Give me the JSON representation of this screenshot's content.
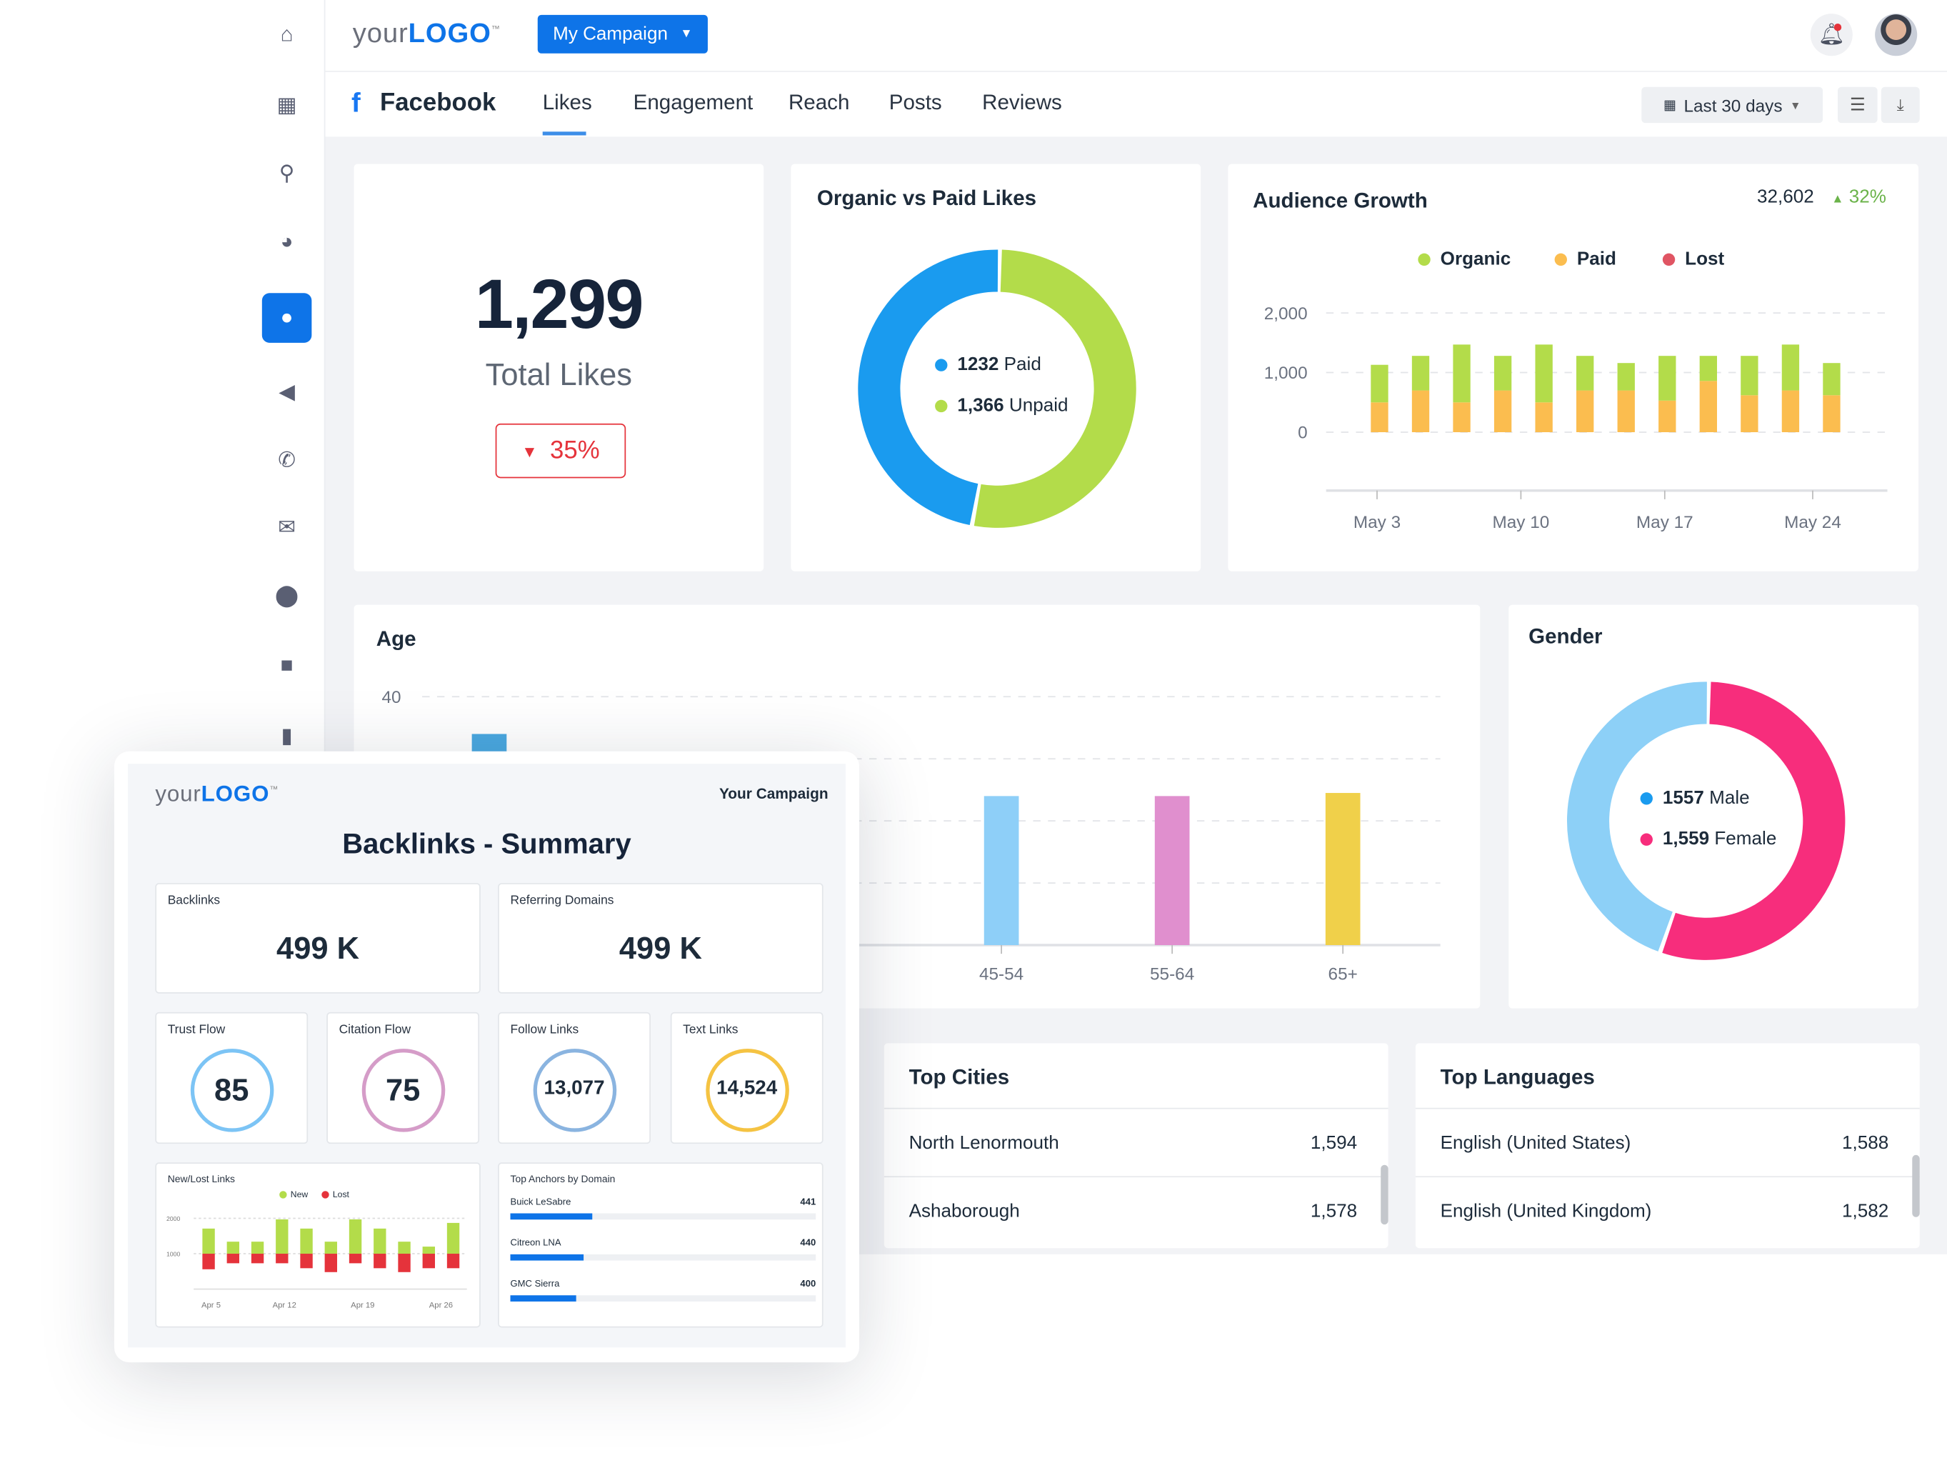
{
  "header": {
    "logo_prefix": "your",
    "logo_main": "LOGO",
    "logo_tm": "™",
    "campaign_button": "My Campaign"
  },
  "sidebar": {
    "items": [
      {
        "name": "home",
        "glyph": "⌂"
      },
      {
        "name": "dashboard",
        "glyph": "▦"
      },
      {
        "name": "search",
        "glyph": "⚲"
      },
      {
        "name": "pie-chart",
        "glyph": "◕"
      },
      {
        "name": "chat",
        "glyph": "●",
        "active": true
      },
      {
        "name": "megaphone",
        "glyph": "◀"
      },
      {
        "name": "phone",
        "glyph": "✆"
      },
      {
        "name": "mail",
        "glyph": "✉"
      },
      {
        "name": "location",
        "glyph": "⬤"
      },
      {
        "name": "briefcase",
        "glyph": "■"
      },
      {
        "name": "file",
        "glyph": "▮"
      }
    ]
  },
  "nav": {
    "platform": "Facebook",
    "tabs": [
      "Likes",
      "Engagement",
      "Reach",
      "Posts",
      "Reviews"
    ],
    "active_tab": "Likes",
    "date_range": "Last 30 days"
  },
  "total_likes": {
    "value": "1,299",
    "label": "Total Likes",
    "change": "35%",
    "direction": "down"
  },
  "organic_paid": {
    "title": "Organic vs Paid Likes",
    "paid_value": 1232,
    "paid_label": "1232",
    "paid_text": "Paid",
    "unpaid_value": 1366,
    "unpaid_label": "1,366",
    "unpaid_text": "Unpaid",
    "colors": {
      "paid": "#1a9bef",
      "unpaid": "#b3dc4a"
    }
  },
  "audience_growth": {
    "title": "Audience Growth",
    "total": "32,602",
    "change": "32%",
    "legend": [
      "Organic",
      "Paid",
      "Lost"
    ],
    "chart_data": {
      "type": "bar",
      "stacked": true,
      "ylim": [
        0,
        2000
      ],
      "yticks": [
        "2,000",
        "1,000",
        "0"
      ],
      "ytick_values": [
        2000,
        1000,
        0
      ],
      "xtick_labels": [
        "May 3",
        "May 10",
        "May 17",
        "May 24"
      ],
      "xtick_bar_index": [
        0,
        3.5,
        7,
        10.6
      ],
      "series": [
        {
          "name": "Paid",
          "color": "#fbbd4f",
          "values": [
            500,
            700,
            500,
            700,
            500,
            700,
            700,
            530,
            860,
            620,
            700,
            620
          ]
        },
        {
          "name": "Organic",
          "color": "#b3dc4a",
          "values": [
            630,
            580,
            970,
            580,
            970,
            580,
            460,
            750,
            420,
            660,
            770,
            540
          ]
        },
        {
          "name": "Lost",
          "color": "#e05563",
          "values": [
            0,
            0,
            0,
            0,
            0,
            0,
            0,
            0,
            0,
            0,
            0,
            0
          ]
        }
      ]
    }
  },
  "age": {
    "title": "Age",
    "chart_data": {
      "type": "bar",
      "ylim": [
        0,
        40
      ],
      "ytick": "40",
      "categories": [
        null,
        null,
        null,
        "45-54",
        "55-64",
        "65+"
      ],
      "values": [
        34,
        null,
        null,
        24,
        24,
        24.5
      ],
      "colors": [
        "#4aa8e0",
        "#8ecff8",
        "#8ecff8",
        "#8ecff8",
        "#e08fce",
        "#f0d04a"
      ]
    }
  },
  "gender": {
    "title": "Gender",
    "male_value": 1557,
    "male_label": "1557",
    "male_text": "Male",
    "female_value": 1559,
    "female_label": "1,559",
    "female_text": "Female",
    "colors": {
      "male": "#8dd0f7",
      "female": "#f72d7c"
    }
  },
  "top_cities": {
    "title": "Top Cities",
    "rows": [
      {
        "name": "North Lenormouth",
        "value": "1,594"
      },
      {
        "name": "Ashaborough",
        "value": "1,578"
      }
    ]
  },
  "top_languages": {
    "title": "Top Languages",
    "rows": [
      {
        "name": "English (United States)",
        "value": "1,588"
      },
      {
        "name": "English (United Kingdom)",
        "value": "1,582"
      }
    ]
  },
  "report": {
    "campaign": "Your Campaign",
    "title": "Backlinks - Summary",
    "backlinks": {
      "label": "Backlinks",
      "value": "499 K"
    },
    "referring": {
      "label": "Referring Domains",
      "value": "499 K"
    },
    "gauges": [
      {
        "label": "Trust Flow",
        "value": "85",
        "color": "#7cc4f5"
      },
      {
        "label": "Citation Flow",
        "value": "75",
        "color": "#d59cc8"
      },
      {
        "label": "Follow Links",
        "value": "13,077",
        "color": "#8ab4e0"
      },
      {
        "label": "Text Links",
        "value": "14,524",
        "color": "#f5c342"
      }
    ],
    "new_lost": {
      "title": "New/Lost Links",
      "legend": [
        "New",
        "Lost"
      ],
      "chart_data": {
        "type": "bar",
        "yticks": [
          "2000",
          "1000"
        ],
        "ytick_values": [
          2000,
          1000
        ],
        "ylim": [
          0,
          2000
        ],
        "xtick_labels": [
          "Apr 5",
          "Apr 12",
          "Apr 19",
          "Apr 26"
        ],
        "xtick_bar_index": [
          0.1,
          3.1,
          6.3,
          9.5
        ],
        "series": [
          {
            "name": "New",
            "color": "#b3dc4a",
            "tops": [
              1710,
              1340,
              1340,
              1970,
              1710,
              1340,
              1970,
              1710,
              1340,
              1200,
              1870
            ]
          },
          {
            "name": "Lost",
            "color": "#e5333b",
            "bottoms": [
              560,
              730,
              730,
              730,
              590,
              480,
              730,
              590,
              480,
              590,
              590
            ]
          }
        ],
        "split": 1000
      }
    },
    "anchors": {
      "title": "Top Anchors by Domain",
      "rows": [
        {
          "name": "Buick LeSabre",
          "value": "441",
          "fill_pct": 27
        },
        {
          "name": "Citreon LNA",
          "value": "440",
          "fill_pct": 24
        },
        {
          "name": "GMC Sierra",
          "value": "400",
          "fill_pct": 21.5
        }
      ]
    }
  }
}
